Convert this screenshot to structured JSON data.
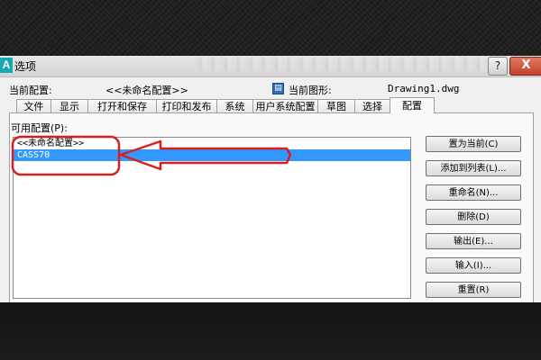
{
  "window": {
    "title": "选项",
    "app_icon_letter": "A",
    "help_glyph": "?",
    "close_glyph": "X"
  },
  "header": {
    "current_profile_label": "当前配置:",
    "current_profile_value": "<<未命名配置>>",
    "current_drawing_label": "当前图形:",
    "current_drawing_value": "Drawing1.dwg"
  },
  "tabs": [
    {
      "label": "文件",
      "active": false
    },
    {
      "label": "显示",
      "active": false
    },
    {
      "label": "打开和保存",
      "active": false
    },
    {
      "label": "打印和发布",
      "active": false
    },
    {
      "label": "系统",
      "active": false
    },
    {
      "label": "用户系统配置",
      "active": false
    },
    {
      "label": "草图",
      "active": false
    },
    {
      "label": "选择",
      "active": false
    },
    {
      "label": "配置",
      "active": true
    }
  ],
  "profiles": {
    "label": "可用配置(P):",
    "items": [
      {
        "label": "<<未命名配置>>",
        "selected": false
      },
      {
        "label": "CASS70",
        "selected": true
      }
    ]
  },
  "buttons": {
    "set_current": "置为当前(C)",
    "add_to_list": "添加到列表(L)...",
    "rename": "重命名(N)...",
    "delete": "删除(D)",
    "export": "输出(E)...",
    "import": "输入(I)...",
    "reset": "重置(R)"
  },
  "colors": {
    "selection": "#3399ff",
    "annotation": "#d81e1e",
    "app_icon": "#18a7b5",
    "close_button": "#c2402a"
  },
  "icons": {
    "app": "autocad-a-icon",
    "drawing": "drawing-file-icon",
    "help": "help-icon",
    "close": "close-icon"
  }
}
